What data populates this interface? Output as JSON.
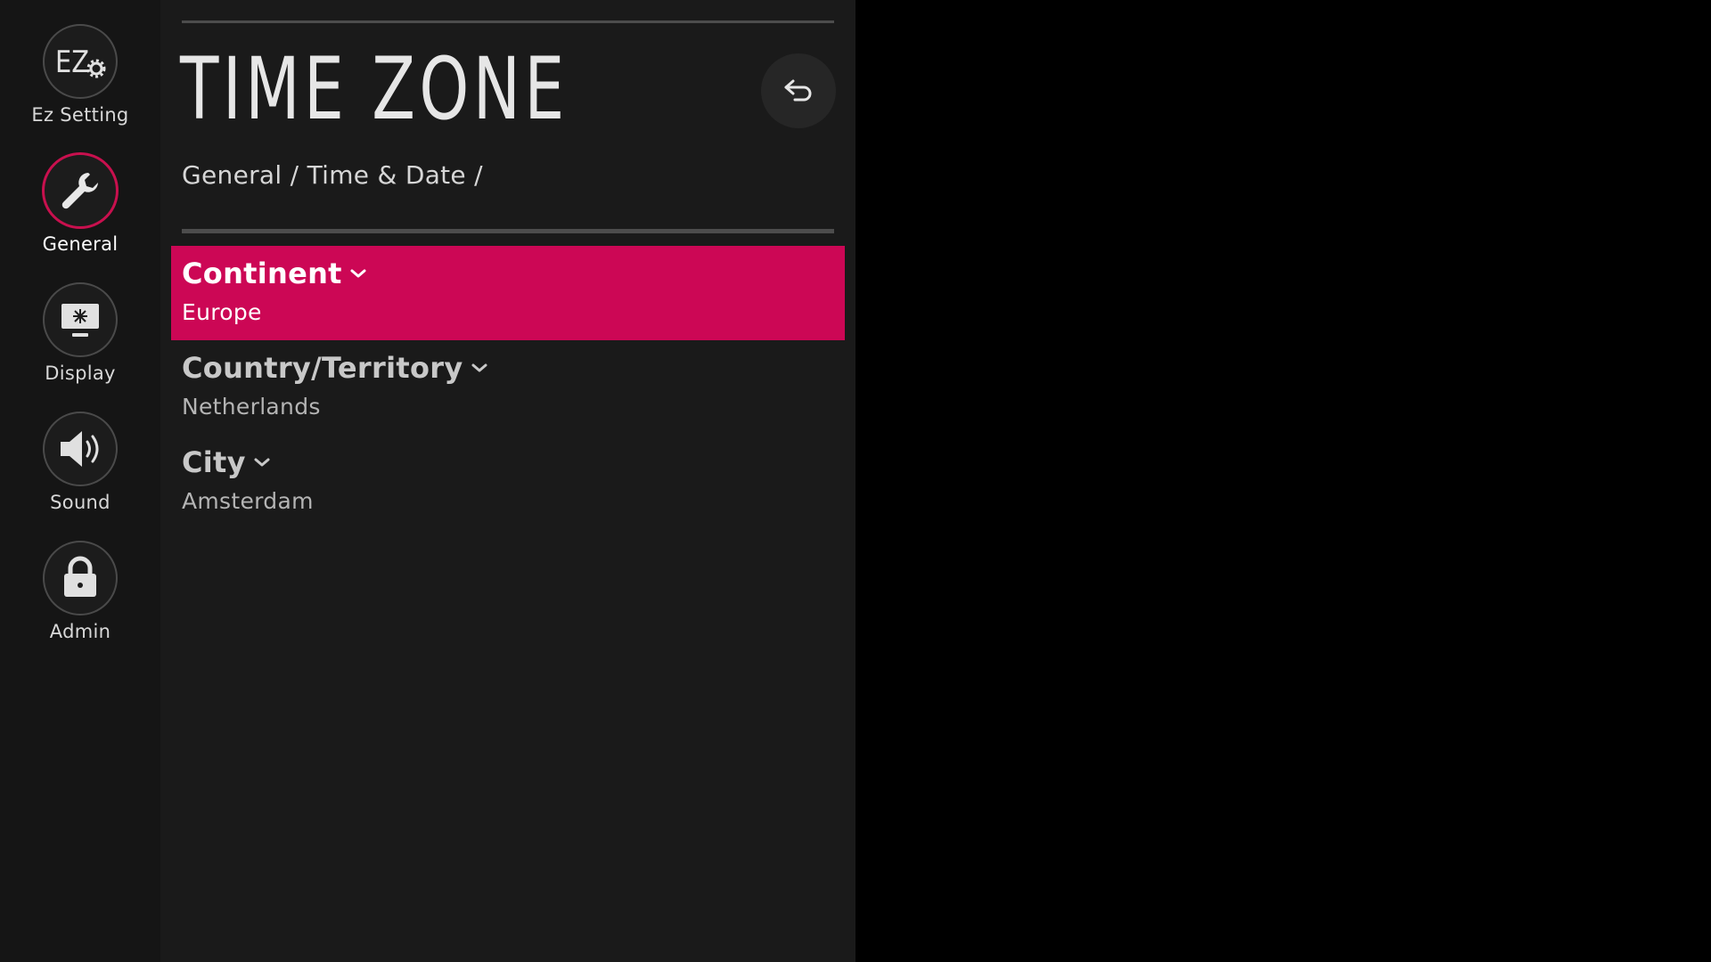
{
  "sidebar": {
    "items": [
      {
        "label": "Ez Setting",
        "icon": "ez-setting-icon",
        "icon_text": "EZ",
        "active": false
      },
      {
        "label": "General",
        "icon": "wrench-icon",
        "active": true
      },
      {
        "label": "Display",
        "icon": "display-icon",
        "active": false
      },
      {
        "label": "Sound",
        "icon": "speaker-icon",
        "active": false
      },
      {
        "label": "Admin",
        "icon": "lock-icon",
        "active": false
      }
    ]
  },
  "header": {
    "title": "TIME ZONE",
    "breadcrumb": "General / Time & Date /",
    "back_icon": "back-arrow-icon"
  },
  "settings": [
    {
      "label": "Continent",
      "value": "Europe",
      "focused": true
    },
    {
      "label": "Country/Territory",
      "value": "Netherlands",
      "focused": false
    },
    {
      "label": "City",
      "value": "Amsterdam",
      "focused": false
    }
  ],
  "colors": {
    "accent": "#cc0755",
    "panel_bg": "#1a1a1a",
    "sidebar_bg": "#151515",
    "screen_bg": "#000000"
  }
}
